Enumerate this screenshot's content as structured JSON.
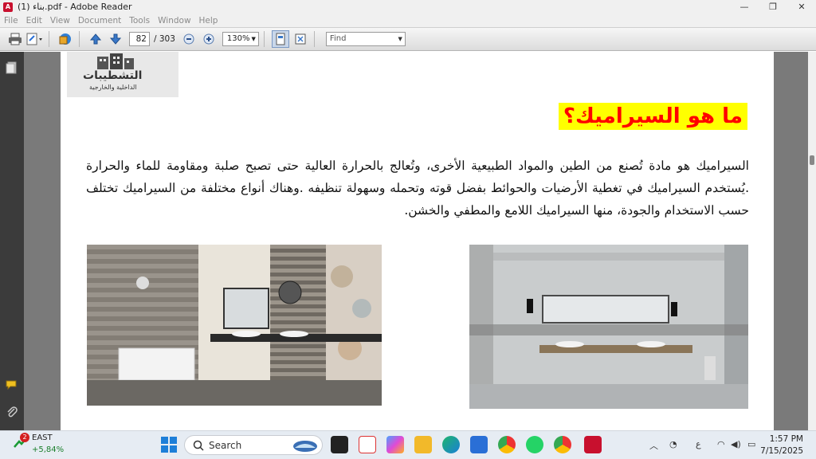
{
  "window": {
    "title": "بناء (1).pdf - Adobe Reader",
    "app_icon_label": "A"
  },
  "menu": [
    "File",
    "Edit",
    "View",
    "Document",
    "Tools",
    "Window",
    "Help"
  ],
  "toolbar": {
    "current_page": "82",
    "total_pages": "/ 303",
    "zoom": "130%",
    "find_placeholder": "Find"
  },
  "document": {
    "logo_title": "التشطيبات",
    "logo_subtitle": "الداخلية والخارجية",
    "heading": "ما هو السيراميك؟",
    "paragraph": "السيراميك هو مادة تُصنع من الطين والمواد الطبيعية الأخرى، وتُعالج بالحرارة العالية حتى تصبح صلبة ومقاومة للماء والحرارة .يُستخدم السيراميك في تغطية الأرضيات والحوائط بفضل قوته وتحمله وسهولة تنظيفه .وهناك أنواع مختلفة من السيراميك تختلف حسب الاستخدام والجودة، منها السيراميك اللامع والمطفي والخشن."
  },
  "taskbar": {
    "notification_count": "2",
    "stock_name": "EAST",
    "stock_change": "+5,84%",
    "search_label": "Search",
    "language": "ع",
    "time": "1:57 PM",
    "date": "7/15/2025"
  },
  "colors": {
    "heading_bg": "#ffff00",
    "heading_text": "#ff0000",
    "nav_pane": "#3b3b3b",
    "doc_bg": "#7a7a7a"
  }
}
